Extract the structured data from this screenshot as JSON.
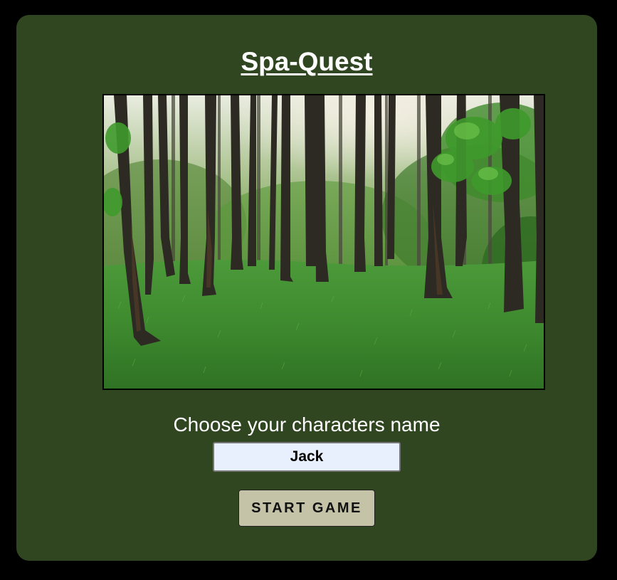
{
  "game": {
    "title": "Spa-Quest"
  },
  "form": {
    "prompt": "Choose your characters name",
    "name_value": "Jack",
    "start_label": "START GAME"
  },
  "colors": {
    "page_background": "#000000",
    "card_background": "#304620",
    "input_background": "#e8f0fe",
    "button_background": "#c4c3a8",
    "text": "#ffffff"
  },
  "image": {
    "subject": "forest-scene",
    "description_icon": "forest-image"
  }
}
